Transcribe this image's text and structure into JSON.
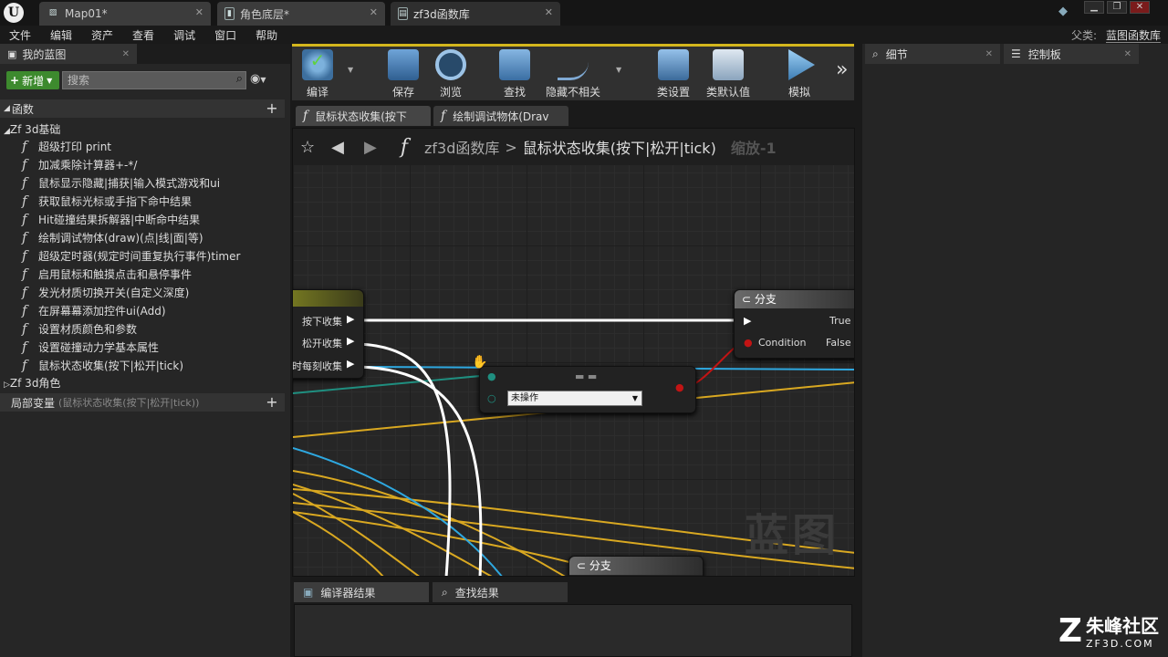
{
  "titlebar": {
    "logo": "U",
    "tabs": [
      {
        "label": "Map01*"
      },
      {
        "label": "角色底层*"
      },
      {
        "label": "zf3d函数库"
      }
    ]
  },
  "menu": [
    "文件",
    "编辑",
    "资产",
    "查看",
    "调试",
    "窗口",
    "帮助"
  ],
  "parent": {
    "label": "父类:",
    "value": "蓝图函数库"
  },
  "left": {
    "tab": "我的蓝图",
    "new_button": "新增",
    "search_placeholder": "搜索",
    "functions_header": "函数",
    "category1": "Zf 3d基础",
    "functions": [
      "超级打印 print",
      "加减乘除计算器+-*/",
      "鼠标显示隐藏|捕获|输入模式游戏和ui",
      "获取鼠标光标或手指下命中结果",
      "Hit碰撞结果拆解器|中断命中结果",
      "绘制调试物体(draw)(点|线|面|等)",
      "超级定时器(规定时间重复执行事件)timer",
      "启用鼠标和触摸点击和悬停事件",
      "发光材质切换开关(自定义深度)",
      "在屏幕幕添加控件ui(Add)",
      "设置材质颜色和参数",
      "设置碰撞动力学基本属性",
      "鼠标状态收集(按下|松开|tick)"
    ],
    "category2": "Zf 3d角色",
    "local_vars": "局部变量",
    "local_vars_hint": "(鼠标状态收集(按下|松开|tick))"
  },
  "toolbar": {
    "compile": "编译",
    "save": "保存",
    "browse": "浏览",
    "find": "查找",
    "hide_unrelated": "隐藏不相关",
    "class_settings": "类设置",
    "class_defaults": "类默认值",
    "simulate": "模拟",
    "more": "»"
  },
  "doc_tabs": [
    "鼠标状态收集(按下",
    "绘制调试物体(Drav"
  ],
  "graph": {
    "breadcrumb_root": "zf3d函数库",
    "breadcrumb_sep": ">",
    "breadcrumb_current": "鼠标状态收集(按下|松开|tick)",
    "zoom": "缩放-1",
    "watermark": "蓝图",
    "node_left_pins": [
      "按下收集",
      "松开收集",
      "时每刻收集"
    ],
    "branch_title": "分支",
    "branch_condition": "Condition",
    "branch_true": "True",
    "branch_false": "False",
    "select_value": "未操作",
    "branch2_title": "分支"
  },
  "bottom_tabs": [
    "编译器结果",
    "查找结果"
  ],
  "right_tabs": [
    "细节",
    "控制板"
  ],
  "logo": {
    "title": "朱峰社区",
    "url": "ZF3D.COM"
  },
  "colors": {
    "accent": "#d4b61d",
    "new_button": "#3d8a2e",
    "exec_wire": "#ffffff",
    "blue_wire": "#2ea8e0",
    "yellow_wire": "#d9a821",
    "bool_pin": "#c21414"
  }
}
